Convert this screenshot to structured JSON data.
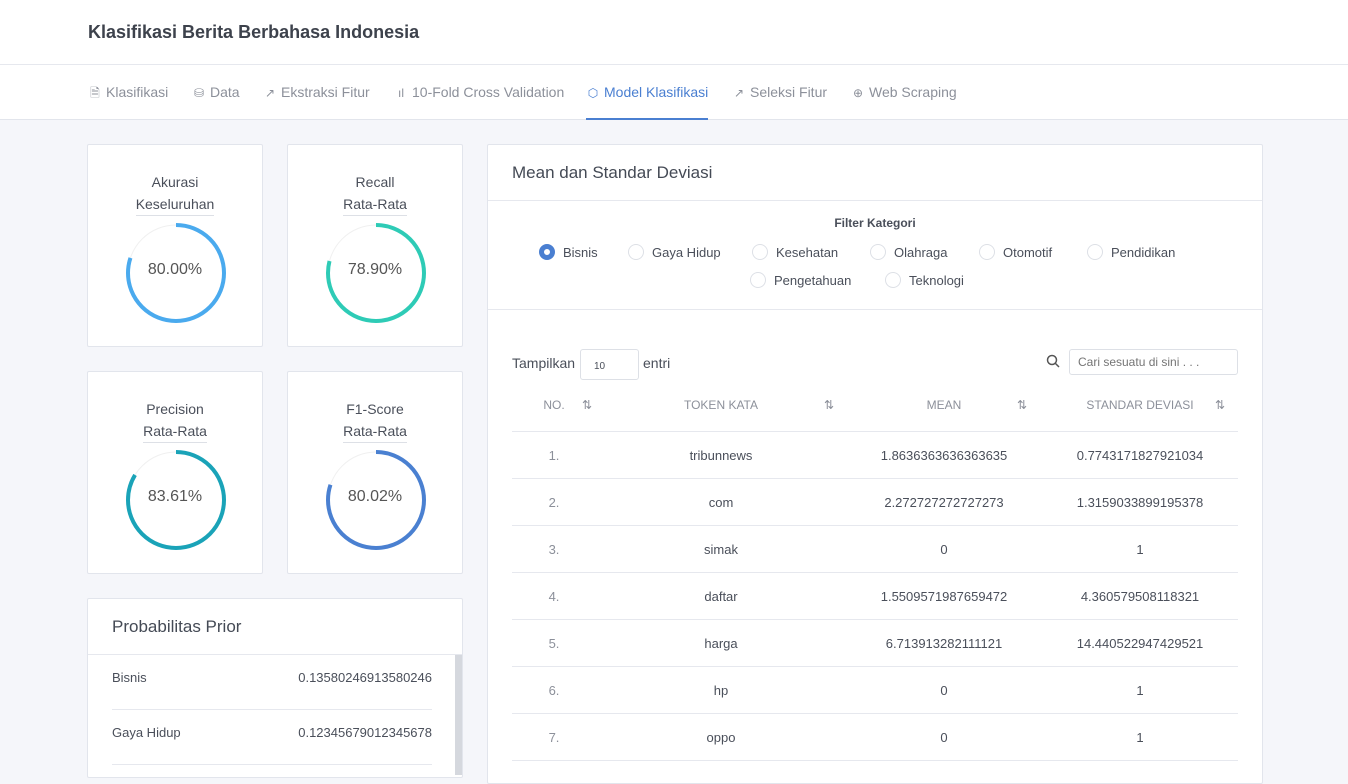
{
  "header": {
    "title": "Klasifikasi Berita Berbahasa Indonesia"
  },
  "nav": [
    {
      "label": "Klasifikasi",
      "icon": "file-icon"
    },
    {
      "label": "Data",
      "icon": "database-icon"
    },
    {
      "label": "Ekstraksi Fitur",
      "icon": "arrow-up-right-icon"
    },
    {
      "label": "10-Fold Cross Validation",
      "icon": "bar-chart-icon"
    },
    {
      "label": "Model Klasifikasi",
      "icon": "box-icon",
      "active": true
    },
    {
      "label": "Seleksi Fitur",
      "icon": "trending-up-icon"
    },
    {
      "label": "Web Scraping",
      "icon": "globe-icon"
    }
  ],
  "metrics": [
    {
      "line1": "Akurasi",
      "line2": "Keseluruhan",
      "value": "80.00%",
      "percent": 80.0,
      "color": "#4aaaee"
    },
    {
      "line1": "Recall",
      "line2": "Rata-Rata",
      "value": "78.90%",
      "percent": 78.9,
      "color": "#2ecbb6"
    },
    {
      "line1": "Precision",
      "line2": "Rata-Rata",
      "value": "83.61%",
      "percent": 83.61,
      "color": "#1aa3b8"
    },
    {
      "line1": "F1-Score",
      "line2": "Rata-Rata",
      "value": "80.02%",
      "percent": 80.02,
      "color": "#4a80d1"
    }
  ],
  "prior": {
    "title": "Probabilitas Prior",
    "rows": [
      {
        "label": "Bisnis",
        "value": "0.13580246913580246"
      },
      {
        "label": "Gaya Hidup",
        "value": "0.12345679012345678"
      }
    ]
  },
  "meanstd": {
    "title": "Mean dan Standar Deviasi",
    "filter_title": "Filter Kategori",
    "categories": [
      "Bisnis",
      "Gaya Hidup",
      "Kesehatan",
      "Olahraga",
      "Otomotif",
      "Pendidikan",
      "Pengetahuan",
      "Teknologi"
    ],
    "selected": "Bisnis",
    "show_label": "Tampilkan",
    "show_value": "10",
    "show_suffix": "entri",
    "search_placeholder": "Cari sesuatu di sini . . .",
    "columns": [
      "NO.",
      "TOKEN KATA",
      "MEAN",
      "STANDAR DEVIASI"
    ],
    "rows": [
      [
        "1.",
        "tribunnews",
        "1.8636363636363635",
        "0.7743171827921034"
      ],
      [
        "2.",
        "com",
        "2.272727272727273",
        "1.3159033899195378"
      ],
      [
        "3.",
        "simak",
        "0",
        "1"
      ],
      [
        "4.",
        "daftar",
        "1.5509571987659472",
        "4.360579508118321"
      ],
      [
        "5.",
        "harga",
        "6.713913282111121",
        "14.440522947429521"
      ],
      [
        "6.",
        "hp",
        "0",
        "1"
      ],
      [
        "7.",
        "oppo",
        "0",
        "1"
      ]
    ]
  }
}
